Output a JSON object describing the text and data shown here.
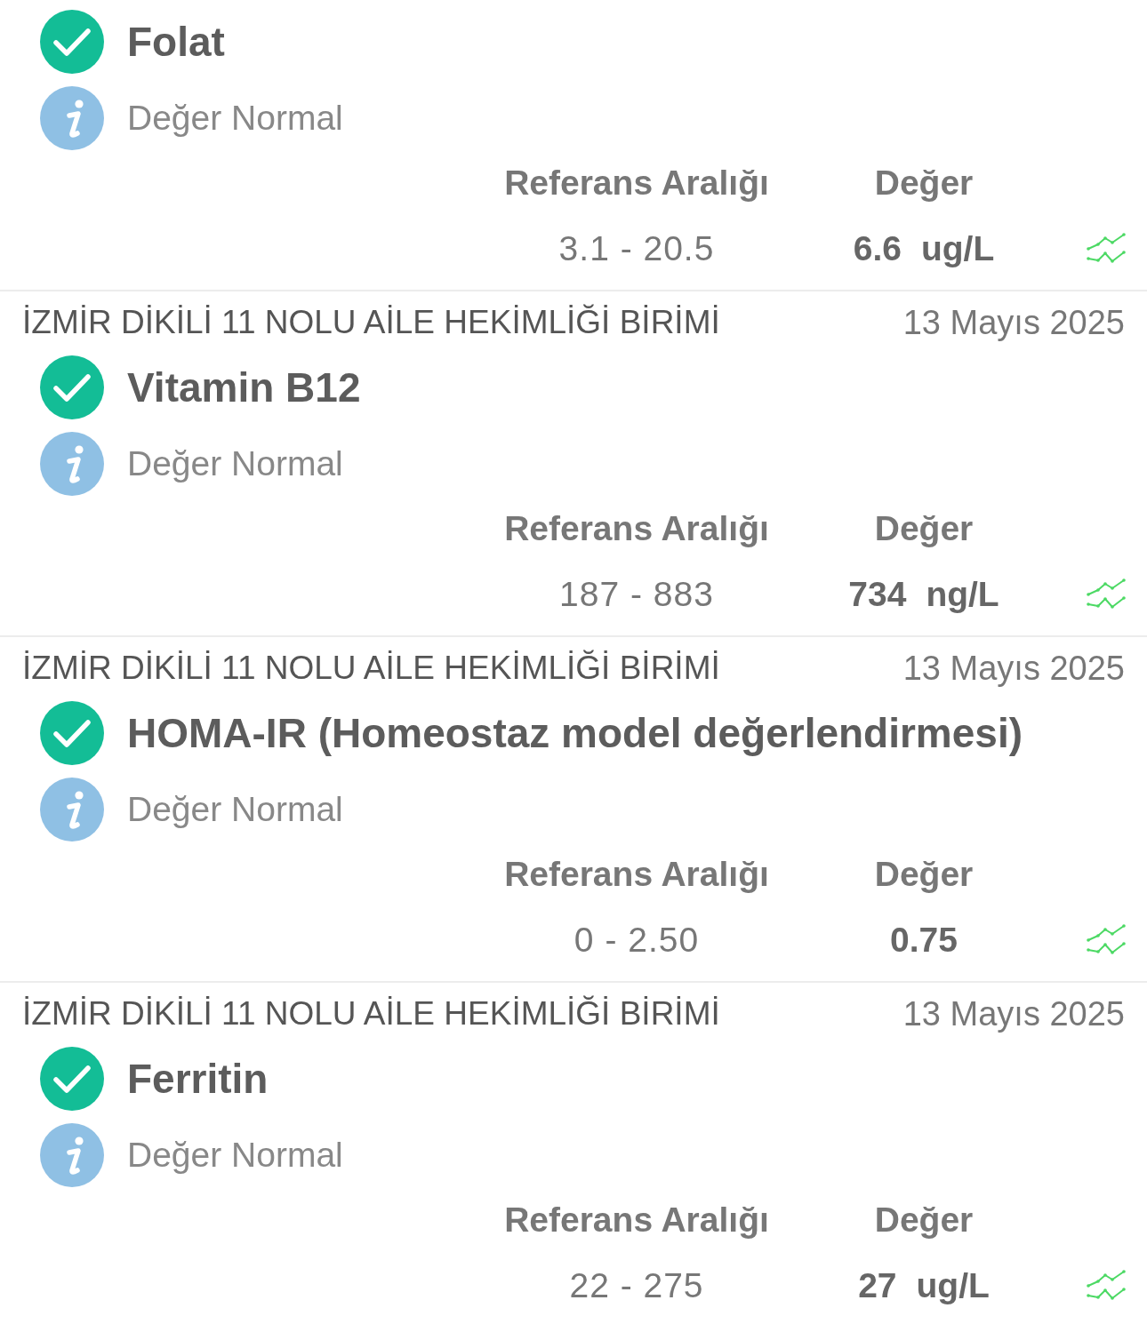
{
  "results": [
    {
      "test": "Folat",
      "normal": true,
      "note": "Değer Normal",
      "reference_label": "Referans Aralığı",
      "value_label": "Değer",
      "reference_range": "3.1 - 20.5",
      "value": "6.6",
      "unit": "ug/L"
    },
    {
      "facility": "İZMİR DİKİLİ 11 NOLU AİLE HEKİMLİĞİ BİRİMİ",
      "date": "13 Mayıs 2025",
      "test": "Vitamin B12",
      "normal": true,
      "note": "Değer Normal",
      "reference_label": "Referans Aralığı",
      "value_label": "Değer",
      "reference_range": "187 - 883",
      "value": "734",
      "unit": "ng/L"
    },
    {
      "facility": "İZMİR DİKİLİ 11 NOLU AİLE HEKİMLİĞİ BİRİMİ",
      "date": "13 Mayıs 2025",
      "test": "HOMA-IR (Homeostaz model değerlendirmesi)",
      "normal": true,
      "note": "Değer Normal",
      "reference_label": "Referans Aralığı",
      "value_label": "Değer",
      "reference_range": "0 - 2.50",
      "value": "0.75"
    },
    {
      "facility": "İZMİR DİKİLİ 11 NOLU AİLE HEKİMLİĞİ BİRİMİ",
      "date": "13 Mayıs 2025",
      "test": "Ferritin",
      "normal": true,
      "note": "Değer Normal",
      "reference_label": "Referans Aralığı",
      "value_label": "Değer",
      "reference_range": "22 - 275",
      "value": "27",
      "unit": "ug/L"
    }
  ]
}
